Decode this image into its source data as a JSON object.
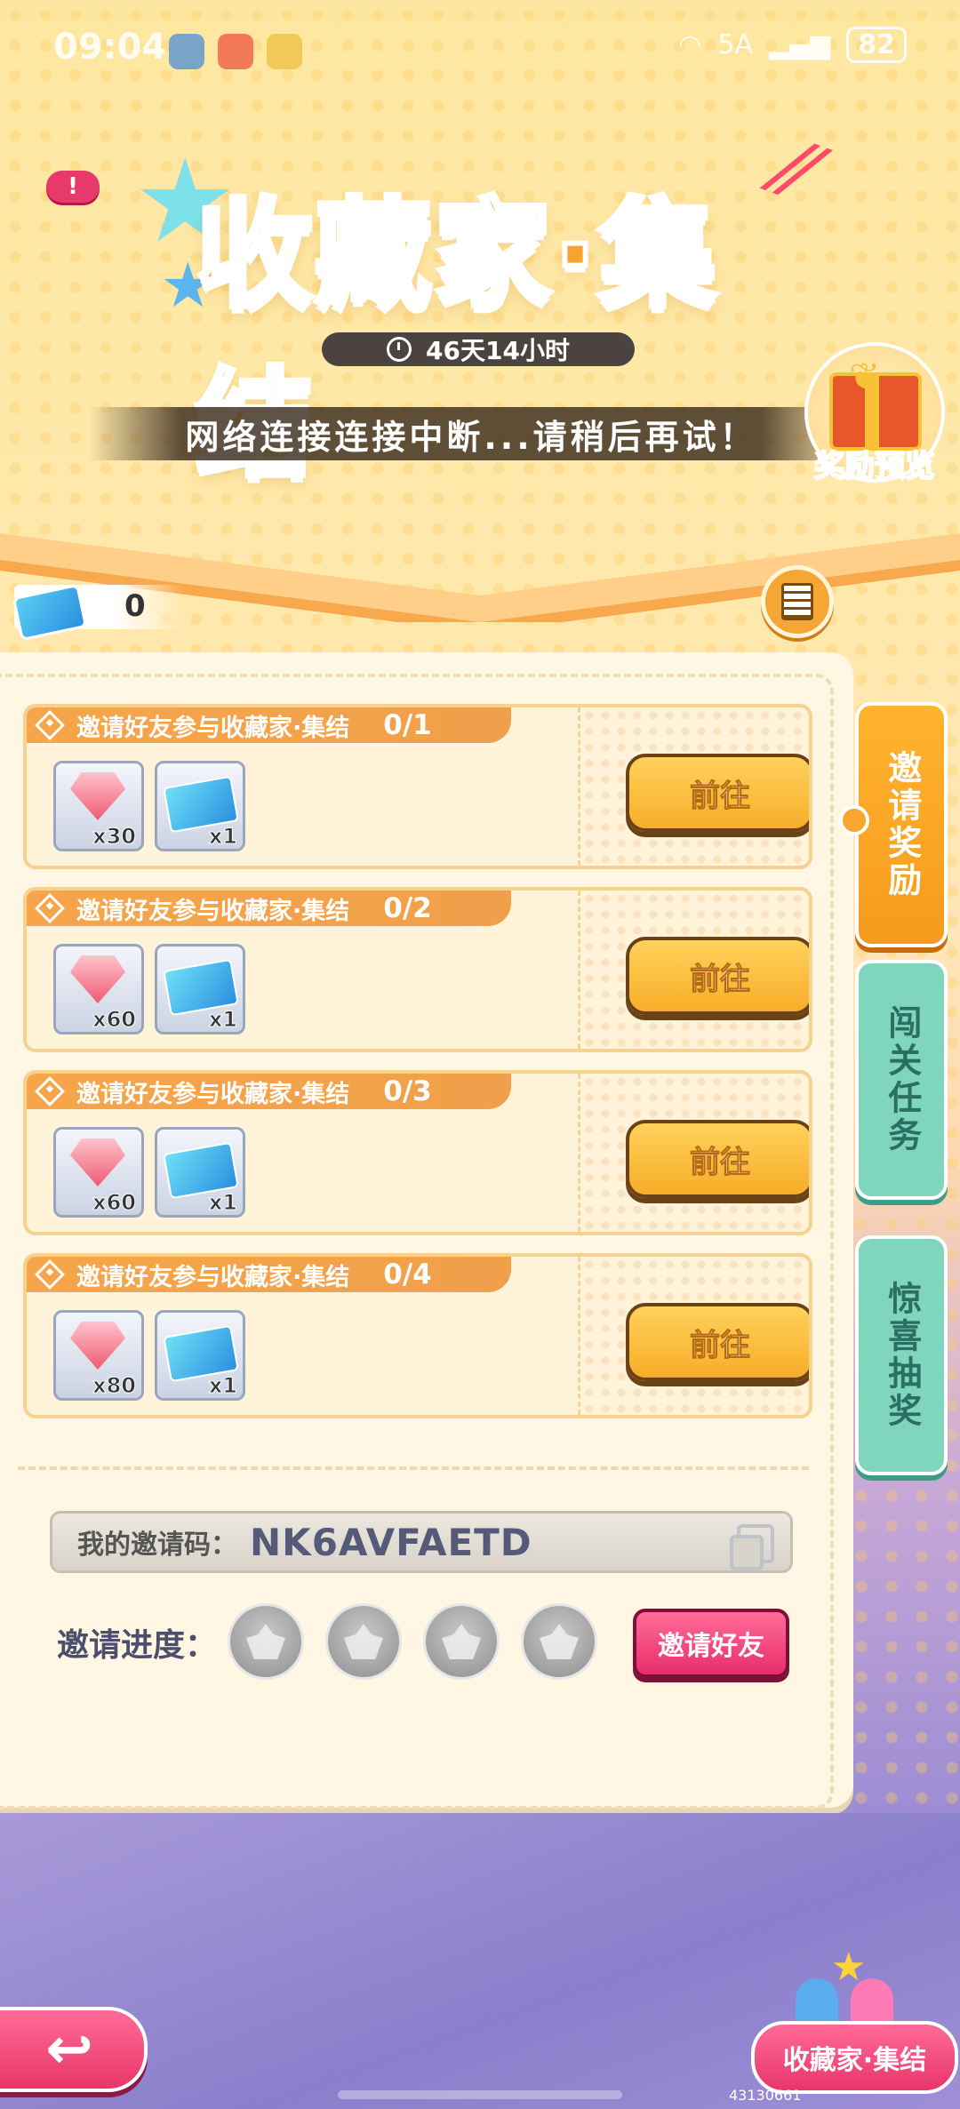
{
  "status_bar": {
    "time": "09:04",
    "network": "5A",
    "battery": "82"
  },
  "event": {
    "title_part1": "收藏家·",
    "title_part2": "集结",
    "countdown": "46天14小时",
    "error_message": "网络连接连接中断...请稍后再试！",
    "reward_preview_label": "奖励预览",
    "ticket_count": "0",
    "info_icon_label": "!"
  },
  "tasks": [
    {
      "title": "邀请好友参与收藏家·集结",
      "progress": "0/1",
      "gem_qty": "x30",
      "ticket_qty": "x1",
      "button": "前往"
    },
    {
      "title": "邀请好友参与收藏家·集结",
      "progress": "0/2",
      "gem_qty": "x60",
      "ticket_qty": "x1",
      "button": "前往"
    },
    {
      "title": "邀请好友参与收藏家·集结",
      "progress": "0/3",
      "gem_qty": "x60",
      "ticket_qty": "x1",
      "button": "前往"
    },
    {
      "title": "邀请好友参与收藏家·集结",
      "progress": "0/4",
      "gem_qty": "x80",
      "ticket_qty": "x1",
      "button": "前往"
    }
  ],
  "invite": {
    "code_label": "我的邀请码：",
    "code_value": "NK6AVFAETD",
    "progress_label": "邀请进度：",
    "invite_button": "邀请好友"
  },
  "side_tabs": {
    "invite_rewards": "邀请奖励",
    "level_tasks": "闯关任务",
    "surprise_lottery": "惊喜抽奖"
  },
  "bottom": {
    "event_label": "收藏家·集结",
    "build_id": "43130661"
  }
}
